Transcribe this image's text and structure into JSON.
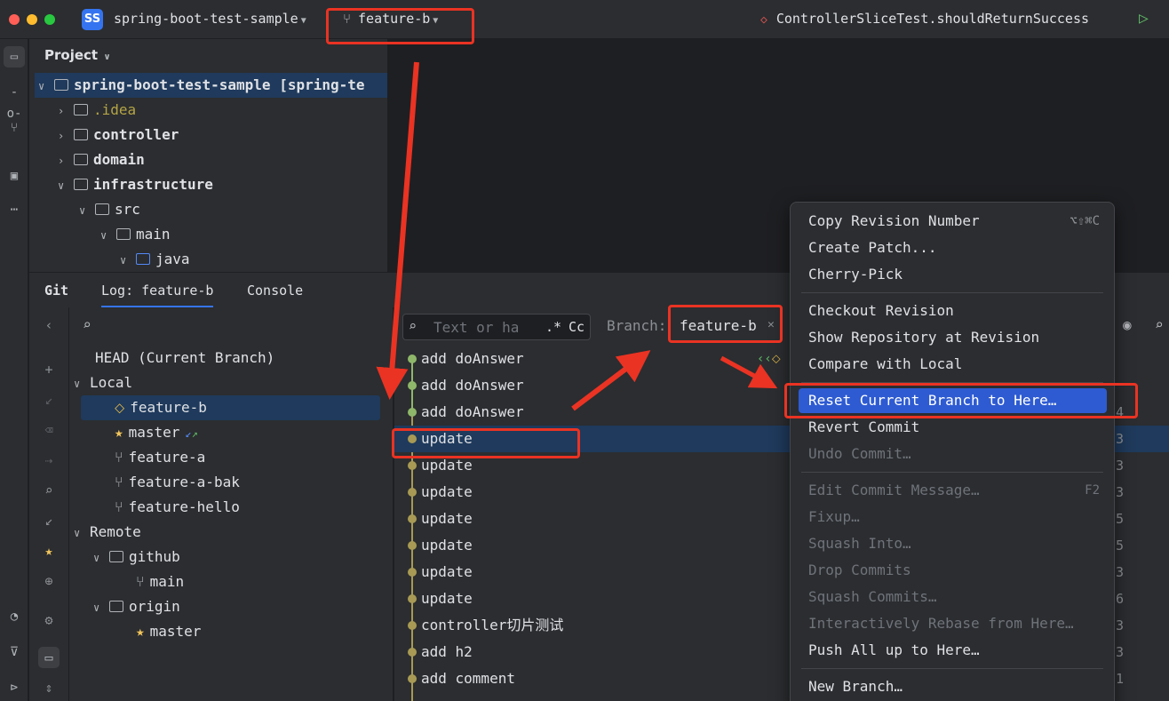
{
  "titlebar": {
    "project_badge": "SS",
    "project_name": "spring-boot-test-sample",
    "branch": "feature-b",
    "run_config": "ControllerSliceTest.shouldReturnSuccess"
  },
  "project_panel": {
    "title": "Project",
    "tree": [
      {
        "label": "spring-boot-test-sample [spring-te"
      },
      {
        "label": ".idea"
      },
      {
        "label": "controller"
      },
      {
        "label": "domain"
      },
      {
        "label": "infrastructure"
      },
      {
        "label": "src"
      },
      {
        "label": "main"
      },
      {
        "label": "java"
      }
    ]
  },
  "git": {
    "tabs": [
      {
        "label": "Git"
      },
      {
        "label": "Log: feature-b"
      },
      {
        "label": "Console"
      }
    ]
  },
  "branches": {
    "head": "HEAD (Current Branch)",
    "local_label": "Local",
    "local": [
      {
        "name": "feature-b"
      },
      {
        "name": "master"
      },
      {
        "name": "feature-a"
      },
      {
        "name": "feature-a-bak"
      },
      {
        "name": "feature-hello"
      }
    ],
    "remote_label": "Remote",
    "github": "github",
    "github_main": "main",
    "origin": "origin",
    "origin_master": "master"
  },
  "log": {
    "filter_placeholder": "Text or ha",
    "regex_toggle": ".*",
    "case_toggle": "Cc",
    "branch_label": "Branch:",
    "branch_value": "feature-b",
    "commits": [
      {
        "msg": "add doAnswer",
        "trail": ""
      },
      {
        "msg": "add doAnswer",
        "trail": ""
      },
      {
        "msg": "add doAnswer",
        "trail": "4"
      },
      {
        "msg": "update",
        "trail": "3"
      },
      {
        "msg": "update",
        "trail": "3"
      },
      {
        "msg": "update",
        "trail": "3"
      },
      {
        "msg": "update",
        "trail": "5"
      },
      {
        "msg": "update",
        "trail": "5"
      },
      {
        "msg": "update",
        "trail": "3"
      },
      {
        "msg": "update",
        "trail": "6"
      },
      {
        "msg": "controller切片测试",
        "trail": "3"
      },
      {
        "msg": "add h2",
        "trail": "3"
      },
      {
        "msg": "add comment",
        "trail": "1"
      }
    ]
  },
  "menu": {
    "items": [
      {
        "label": "Copy Revision Number",
        "shortcut": "⌥⇧⌘C"
      },
      {
        "label": "Create Patch..."
      },
      {
        "label": "Cherry-Pick"
      },
      {
        "label": "Checkout Revision"
      },
      {
        "label": "Show Repository at Revision"
      },
      {
        "label": "Compare with Local"
      },
      {
        "label": "Reset Current Branch to Here…"
      },
      {
        "label": "Revert Commit"
      },
      {
        "label": "Undo Commit…"
      },
      {
        "label": "Edit Commit Message…",
        "shortcut": "F2"
      },
      {
        "label": "Fixup…"
      },
      {
        "label": "Squash Into…"
      },
      {
        "label": "Drop Commits"
      },
      {
        "label": "Squash Commits…"
      },
      {
        "label": "Interactively Rebase from Here…"
      },
      {
        "label": "Push All up to Here…"
      },
      {
        "label": "New Branch…"
      }
    ]
  },
  "colors": {
    "accent": "#3574f0",
    "selection": "#1f3a5c",
    "menu_highlight": "#2e5bd2",
    "annotation_red": "#ea3323"
  }
}
